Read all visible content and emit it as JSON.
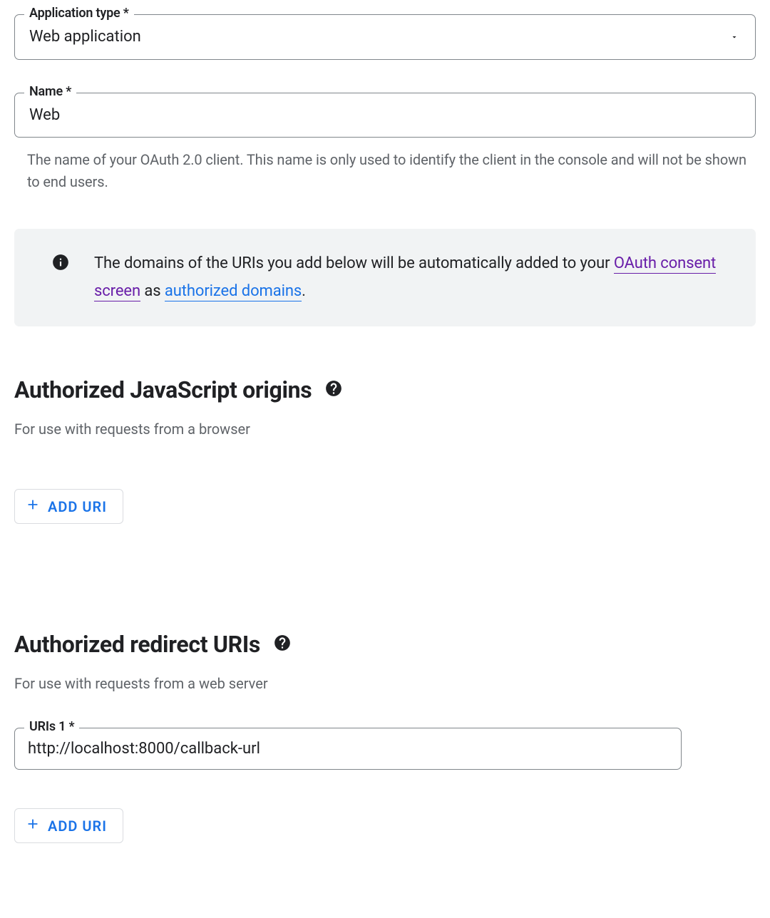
{
  "app_type": {
    "label": "Application type *",
    "value": "Web application"
  },
  "name_field": {
    "label": "Name *",
    "value": "Web",
    "help": "The name of your OAuth 2.0 client. This name is only used to identify the client in the console and will not be shown to end users."
  },
  "info": {
    "pre": "The domains of the URIs you add below will be automatically added to your ",
    "link1": "OAuth consent screen",
    "mid": " as ",
    "link2": "authorized domains",
    "post": "."
  },
  "js_origins": {
    "title": "Authorized JavaScript origins",
    "sub": "For use with requests from a browser",
    "add_label": "ADD URI"
  },
  "redirect_uris": {
    "title": "Authorized redirect URIs",
    "sub": "For use with requests from a web server",
    "uri1_label": "URIs 1 *",
    "uri1_value": "http://localhost:8000/callback-url",
    "add_label": "ADD URI"
  }
}
